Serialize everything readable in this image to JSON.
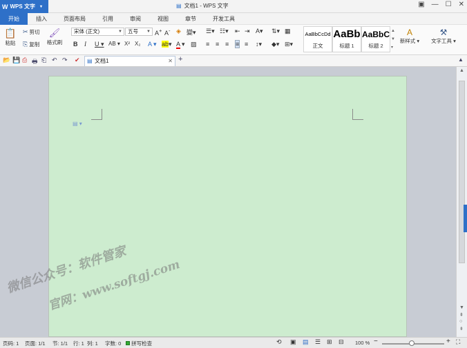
{
  "app": {
    "name": "WPS 文字",
    "window_title": "文档1 - WPS 文字"
  },
  "menu": [
    "开始",
    "插入",
    "页面布局",
    "引用",
    "审阅",
    "视图",
    "章节",
    "开发工具"
  ],
  "ribbon": {
    "paste": "粘贴",
    "cut": "剪切",
    "copy": "复制",
    "format_painter": "格式刷",
    "font_name": "宋体 (正文)",
    "font_size": "五号",
    "styles": [
      {
        "sample": "AaBbCcDd",
        "label": "正文"
      },
      {
        "sample": "AaBb",
        "label": "标题 1"
      },
      {
        "sample": "AaBbC",
        "label": "标题 2"
      }
    ],
    "new_style": "新样式",
    "text_tools": "文字工具"
  },
  "quick": {
    "doc_tab": "文档1"
  },
  "watermark": {
    "line1": "微信公众号：软件管家",
    "line2": "官网：www.softgj.com"
  },
  "status": {
    "page": "页码: 1",
    "pages": "页面: 1/1",
    "section": "节: 1/1",
    "row": "行: 1",
    "col": "列: 1",
    "words": "字数: 0",
    "spell": "拼写检查",
    "zoom": "100 %"
  }
}
